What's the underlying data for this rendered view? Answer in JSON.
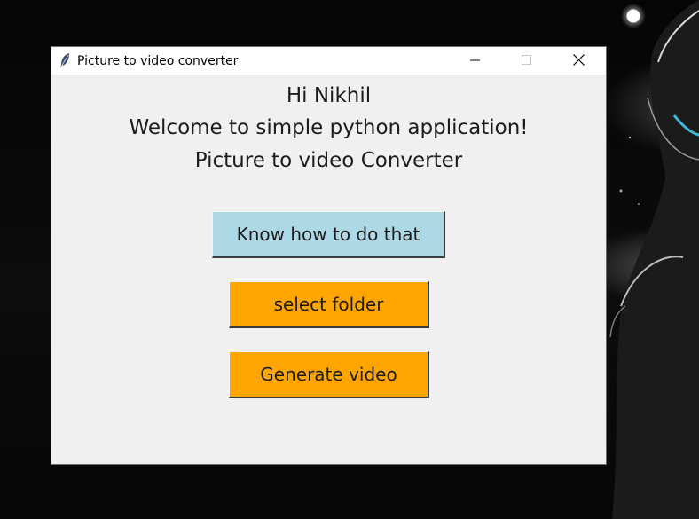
{
  "window": {
    "title": "Picture to video converter",
    "icon": "feather-icon",
    "controls": {
      "minimize_icon": "minimize-icon",
      "maximize_icon": "maximize-icon",
      "close_icon": "close-icon"
    }
  },
  "content": {
    "greeting": "Hi Nikhil",
    "welcome": "Welcome to simple python application!",
    "subtitle": "Picture to video Converter"
  },
  "buttons": {
    "info_label": "Know how to do that",
    "select_folder_label": "select folder",
    "generate_label": "Generate video"
  },
  "colors": {
    "window_bg": "#f0f0f0",
    "info_button_bg": "#add8e6",
    "action_button_bg": "#ffa500",
    "titlebar_bg": "#ffffff"
  }
}
